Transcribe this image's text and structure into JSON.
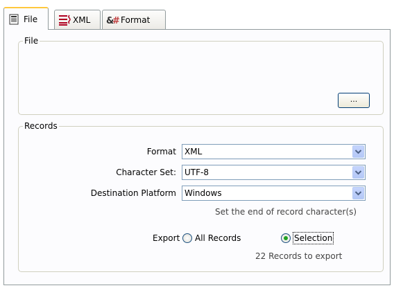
{
  "tabs": [
    {
      "label": "File",
      "icon": "file-icon",
      "active": true
    },
    {
      "label": "XML",
      "icon": "xml-icon",
      "active": false
    },
    {
      "label": "Format",
      "icon": "format-icon",
      "active": false
    }
  ],
  "file_group": {
    "title": "File",
    "browse_label": "..."
  },
  "records_group": {
    "title": "Records",
    "format": {
      "label": "Format",
      "value": "XML"
    },
    "charset": {
      "label": "Character Set:",
      "value": "UTF-8"
    },
    "platform": {
      "label": "Destination Platform",
      "value": "Windows"
    },
    "platform_hint": "Set the end of record character(s)",
    "export": {
      "label": "Export",
      "options": [
        "All Records",
        "Selection"
      ],
      "selected": "Selection"
    },
    "count_text": "22 Records to export"
  },
  "colors": {
    "accent_tab": "#ffc83c",
    "radio_selected": "#21a121",
    "dropdown_button": "#b4c8f6"
  }
}
